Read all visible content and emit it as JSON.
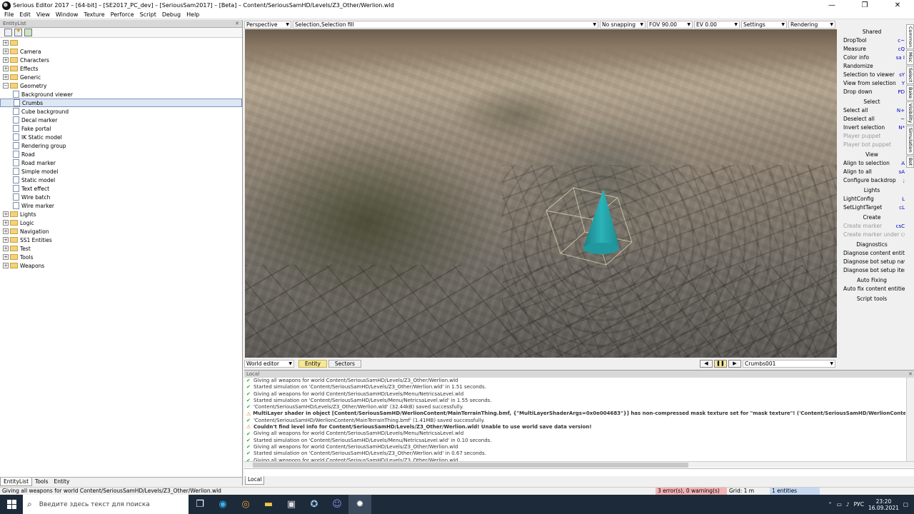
{
  "window": {
    "title": "Serious Editor 2017 – [64-bit] – [SE2017_PC_dev] – [SeriousSam2017] – [Beta] – Content/SeriousSamHD/Levels/Z3_Other/Werlion.wld",
    "minimize": "—",
    "maximize": "❐",
    "close": "✕"
  },
  "menu": [
    "File",
    "Edit",
    "View",
    "Window",
    "Texture",
    "Perforce",
    "Script",
    "Debug",
    "Help"
  ],
  "entity_list": {
    "title": "EntityList",
    "close": "✕",
    "tree": [
      {
        "label": "",
        "kind": "folder",
        "expanded": false
      },
      {
        "label": "Camera",
        "kind": "folder",
        "expanded": false
      },
      {
        "label": "Characters",
        "kind": "folder",
        "expanded": false
      },
      {
        "label": "Effects",
        "kind": "folder",
        "expanded": false
      },
      {
        "label": "Generic",
        "kind": "folder",
        "expanded": false
      },
      {
        "label": "Geometry",
        "kind": "folder",
        "expanded": true
      },
      {
        "label": "Background viewer",
        "kind": "item"
      },
      {
        "label": "Crumbs",
        "kind": "item",
        "selected": true
      },
      {
        "label": "Cube background",
        "kind": "item"
      },
      {
        "label": "Decal marker",
        "kind": "item"
      },
      {
        "label": "Fake portal",
        "kind": "item"
      },
      {
        "label": "IK Static model",
        "kind": "item"
      },
      {
        "label": "Rendering group",
        "kind": "item"
      },
      {
        "label": "Road",
        "kind": "item"
      },
      {
        "label": "Road marker",
        "kind": "item"
      },
      {
        "label": "Simple model",
        "kind": "item"
      },
      {
        "label": "Static model",
        "kind": "item"
      },
      {
        "label": "Text effect",
        "kind": "item"
      },
      {
        "label": "Wire batch",
        "kind": "item"
      },
      {
        "label": "Wire marker",
        "kind": "item"
      },
      {
        "label": "Lights",
        "kind": "folder",
        "expanded": false
      },
      {
        "label": "Logic",
        "kind": "folder",
        "expanded": false
      },
      {
        "label": "Navigation",
        "kind": "folder",
        "expanded": false
      },
      {
        "label": "SS1 Entities",
        "kind": "folder",
        "expanded": false
      },
      {
        "label": "Test",
        "kind": "folder",
        "expanded": false
      },
      {
        "label": "Tools",
        "kind": "folder",
        "expanded": false
      },
      {
        "label": "Weapons",
        "kind": "folder",
        "expanded": false
      }
    ],
    "tabs": [
      "EntityList",
      "Tools",
      "Entity"
    ]
  },
  "viewport_toolbar": {
    "view_mode": "Perspective",
    "selection_mode": "Selection,Selection fill",
    "snapping": "No snapping",
    "fov": "FOV 90.00",
    "ev": "EV  0.00",
    "settings": "Settings",
    "rendering": "Rendering"
  },
  "editor_bar": {
    "mode": "World editor",
    "tabs": [
      "Entity",
      "Sectors"
    ],
    "active_tab": "Entity",
    "play_controls": [
      "◀",
      "❚❚",
      "▶"
    ],
    "current_entity": "Crumbs001"
  },
  "right_panel": {
    "sections": [
      {
        "header": "Shared",
        "items": [
          {
            "label": "DropTool",
            "key": "c~",
            "disabled": false
          },
          {
            "label": "Measure",
            "key": "cQ",
            "disabled": false
          },
          {
            "label": "Color info",
            "key": "sa I",
            "disabled": false
          },
          {
            "label": "Randomize",
            "key": "",
            "disabled": false
          },
          {
            "label": "Selection to viewer",
            "key": "sY",
            "disabled": false
          },
          {
            "label": "View from selection",
            "key": "Y",
            "disabled": false
          },
          {
            "label": "Drop down",
            "key": "PD",
            "disabled": false
          }
        ]
      },
      {
        "header": "Select",
        "items": [
          {
            "label": "Select all",
            "key": "N+",
            "disabled": false
          },
          {
            "label": "Deselect all",
            "key": "~",
            "disabled": false
          },
          {
            "label": "Invert selection",
            "key": "N*",
            "disabled": false
          },
          {
            "label": "Player puppet",
            "key": "",
            "disabled": true
          },
          {
            "label": "Player bot puppet",
            "key": "",
            "disabled": true
          }
        ]
      },
      {
        "header": "View",
        "items": [
          {
            "label": "Align to selection",
            "key": "A",
            "disabled": false
          },
          {
            "label": "Align to all",
            "key": "sA",
            "disabled": false
          },
          {
            "label": "Configure backdrop",
            "key": ";",
            "disabled": false
          }
        ]
      },
      {
        "header": "Lights",
        "items": [
          {
            "label": "LightConfig",
            "key": "L",
            "disabled": false
          },
          {
            "label": "SetLightTarget",
            "key": "cL",
            "disabled": false
          }
        ]
      },
      {
        "header": "Create",
        "items": [
          {
            "label": "Create marker",
            "key": "csC",
            "disabled": true
          },
          {
            "label": "Create marker under cursor",
            "key": "",
            "disabled": true
          }
        ]
      },
      {
        "header": "Diagnostics",
        "items": [
          {
            "label": "Diagnose content entities",
            "key": "",
            "disabled": false
          },
          {
            "label": "Diagnose bot setup navigation",
            "key": "",
            "disabled": false
          },
          {
            "label": "Diagnose bot setup items",
            "key": "",
            "disabled": false
          }
        ]
      },
      {
        "header": "Auto Fixing",
        "items": [
          {
            "label": "Auto fix content entities",
            "key": "",
            "disabled": false
          }
        ]
      },
      {
        "header": "Script tools",
        "items": []
      }
    ],
    "vertical_tabs": [
      "Common",
      "Misc",
      "Select",
      "Bake",
      "Visibility",
      "Simulation",
      "Bot"
    ],
    "active_vertical_tab": "Common"
  },
  "log": {
    "title": "Local",
    "lines": [
      {
        "type": "ok",
        "bold": false,
        "text": "Giving all weapons for world Content/SeriousSamHD/Levels/Z3_Other/Werlion.wld"
      },
      {
        "type": "ok",
        "bold": false,
        "text": "Started simulation on 'Content/SeriousSamHD/Levels/Z3_Other/Werlion.wld' in 1.51 seconds."
      },
      {
        "type": "ok",
        "bold": false,
        "text": "Giving all weapons for world Content/SeriousSamHD/Levels/Menu/NetricsaLevel.wld"
      },
      {
        "type": "ok",
        "bold": false,
        "text": "Started simulation on 'Content/SeriousSamHD/Levels/Menu/NetricsaLevel.wld' in 1.55 seconds."
      },
      {
        "type": "ok",
        "bold": false,
        "text": "'Content/SeriousSamHD/Levels/Z3_Other/Werlion.wld' (32.44kB) saved successfully."
      },
      {
        "type": "warn",
        "bold": true,
        "text": "MultiLayer shader in object [Content/SeriousSamHD/WerlionContent/MainTerrainThing.bmf, {\"MultiLayerShaderArgs=0x0e004683\"}] has non-compressed mask texture set for \"mask texture\"! ('Content/SeriousSamHD/WerlionContent/Terra"
      },
      {
        "type": "ok",
        "bold": false,
        "text": "'Content/SeriousSamHD/WerlionContent/MainTerrainThing.bmf' (1.41MB) saved successfully."
      },
      {
        "type": "warn",
        "bold": true,
        "text": "Couldn't find level info for Content/SeriousSamHD/Levels/Z3_Other/Werlion.wld! Unable to use world save data version!"
      },
      {
        "type": "ok",
        "bold": false,
        "text": "Giving all weapons for world Content/SeriousSamHD/Levels/Menu/NetricsaLevel.wld"
      },
      {
        "type": "ok",
        "bold": false,
        "text": "Started simulation on 'Content/SeriousSamHD/Levels/Menu/NetricsaLevel.wld' in 0.10 seconds."
      },
      {
        "type": "ok",
        "bold": false,
        "text": "Giving all weapons for world Content/SeriousSamHD/Levels/Z3_Other/Werlion.wld"
      },
      {
        "type": "ok",
        "bold": false,
        "text": "Started simulation on 'Content/SeriousSamHD/Levels/Z3_Other/Werlion.wld' in 0.67 seconds."
      },
      {
        "type": "ok",
        "bold": false,
        "text": "Giving all weapons for world Content/SeriousSamHD/Levels/Z3_Other/Werlion.wld"
      }
    ],
    "tab": "Local"
  },
  "statusbar": {
    "message": "Giving all weapons for world Content/SeriousSamHD/Levels/Z3_Other/Werlion.wld",
    "errors": "3 error(s), 0 warning(s)",
    "grid": "Grid: 1 m",
    "entities": "1 entities",
    "colors": {
      "errors_bg": "#f4b4b4",
      "entities_bg": "#c7d9f2"
    }
  },
  "taskbar": {
    "search_placeholder": "Введите здесь текст для поиска",
    "apps": [
      "task-view-icon",
      "edge-icon",
      "chrome-icon",
      "explorer-icon",
      "store-icon",
      "steam-icon",
      "discord-icon",
      "serious-editor-icon"
    ],
    "language": "РУС",
    "time": "23:20",
    "date": "16.09.2021"
  }
}
